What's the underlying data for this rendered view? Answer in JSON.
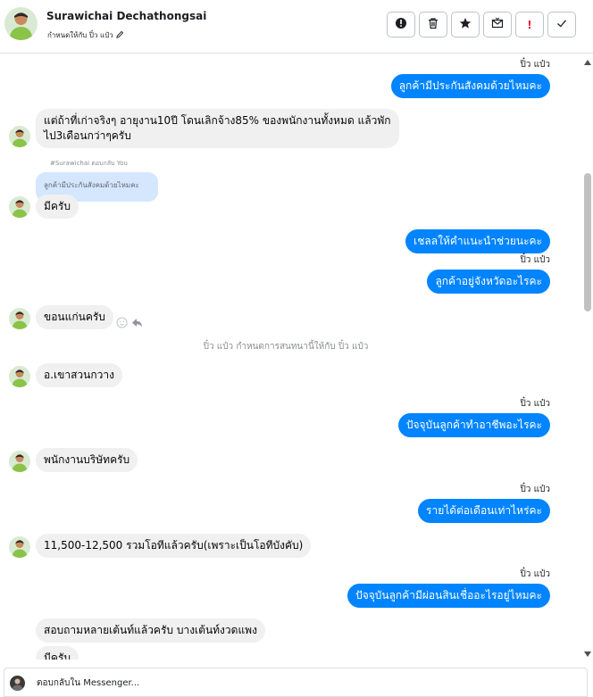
{
  "header": {
    "contact_name": "Surawichai Dechathongsai",
    "assigned_text": "กำหนดให้กับ ปิ๋ว แป๋ว",
    "edit_icon": "pencil-icon",
    "actions": [
      {
        "name": "report-button",
        "icon": "exclamation-circle-icon"
      },
      {
        "name": "delete-button",
        "icon": "trash-icon"
      },
      {
        "name": "star-button",
        "icon": "star-icon"
      },
      {
        "name": "mark-unread-button",
        "icon": "envelope-icon"
      },
      {
        "name": "spam-button",
        "label": "!"
      },
      {
        "name": "done-button",
        "icon": "check-icon"
      }
    ]
  },
  "messages": {
    "m1_sender": "ปิ๋ว แป๋ว",
    "m1_text": "ลูกค้ามีประกันสังคมด้วยไหมคะ",
    "m2_line1": "แต่ถ้าที่เก่าจริงๆ อายุงาน10ปี โดนเลิกจ้าง85% ของพนักงานทั้งหมด  แล้วพัก",
    "m2_line2": "ไป3เดือนกว่าๆครับ",
    "reply_note": "#Surawichai ตอบกลับ You",
    "quoted_text": "ลูกค้ามีประกันสังคมด้วยไหมคะ",
    "m3_text": "มีครับ",
    "m4_text": "เชลลให้คำแนะนำช่วยนะคะ",
    "m5_sender": "ปิ๋ว แป๋ว",
    "m5_text": "ลูกค้าอยู่จังหวัดอะไรคะ",
    "m6_text": "ขอนแก่นครับ",
    "system_note": "ปิ๋ว แป๋ว กำหนดการสนทนานี้ให้กับ ปิ๋ว แป๋ว",
    "m7_text": "อ.เขาสวนกวาง",
    "m8_sender": "ปิ๋ว แป๋ว",
    "m8_text": "ปัจจุบันลูกค้าทำอาชีพอะไรคะ",
    "m9_text": "พนักงานบริษัทครับ",
    "m10_sender": "ปิ๋ว แป๋ว",
    "m10_text": "รายได้ต่อเดือนเท่าไหร่คะ",
    "m11_text": "11,500-12,500 รวมโอทีแล้วครับ(เพราะเป็นโอทีบังคับ)",
    "m12_sender": "ปิ๋ว แป๋ว",
    "m12_text": "ปัจจุบันลูกค้ามีผ่อนสินเชื่ออะไรอยู่ไหมคะ",
    "m13_text": "สอบถามหลายเต้นท์แล้วครับ บางเต้นท์งวดแพง",
    "m14_text": "มีครับ"
  },
  "composer": {
    "placeholder": "ตอบกลับใน Messenger..."
  },
  "colors": {
    "outgoing_bubble": "#0084ff",
    "incoming_bubble": "#f0f0f0",
    "quoted_bubble": "#d5e7ff",
    "spam_red": "#e41e3f"
  }
}
